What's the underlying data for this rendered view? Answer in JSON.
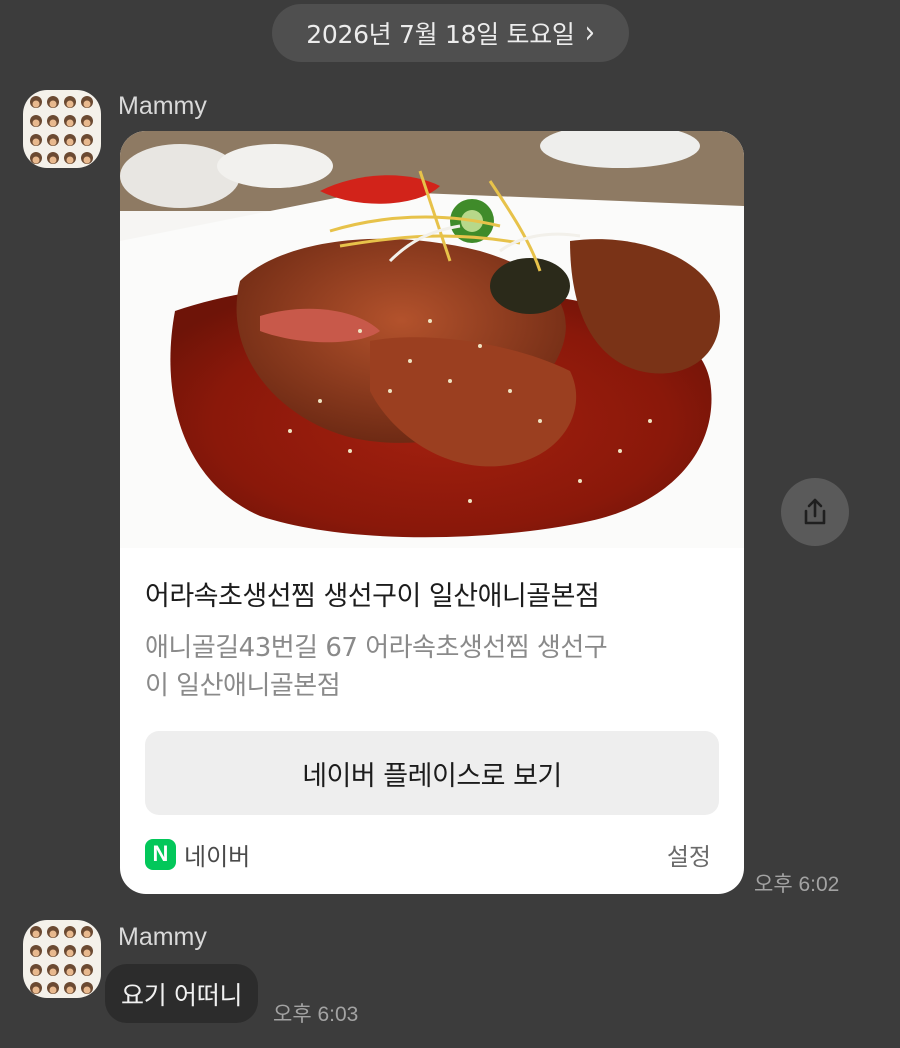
{
  "date_divider": {
    "label": "2026년 7월 18일 토요일"
  },
  "messages": [
    {
      "sender": "Mammy",
      "type": "place-card",
      "card": {
        "title": "어라속초생선찜 생선구이 일산애니골본점",
        "description": "애니골길43번길 67 어라속초생선찜 생선구\n이 일산애니골본점",
        "button_label": "네이버 플레이스로 보기",
        "brand_logo_letter": "N",
        "brand_name": "네이버",
        "settings_label": "설정"
      },
      "time": "오후 6:02"
    },
    {
      "sender": "Mammy",
      "type": "text",
      "text": "요기 어떠니",
      "time": "오후 6:03"
    }
  ],
  "icons": {
    "date_chevron": "chevron-right-icon",
    "share": "share-upload-icon"
  },
  "colors": {
    "background": "#3c3c3c",
    "card": "#ffffff",
    "naver_green": "#03c75a",
    "bubble": "#2c2c2c"
  }
}
